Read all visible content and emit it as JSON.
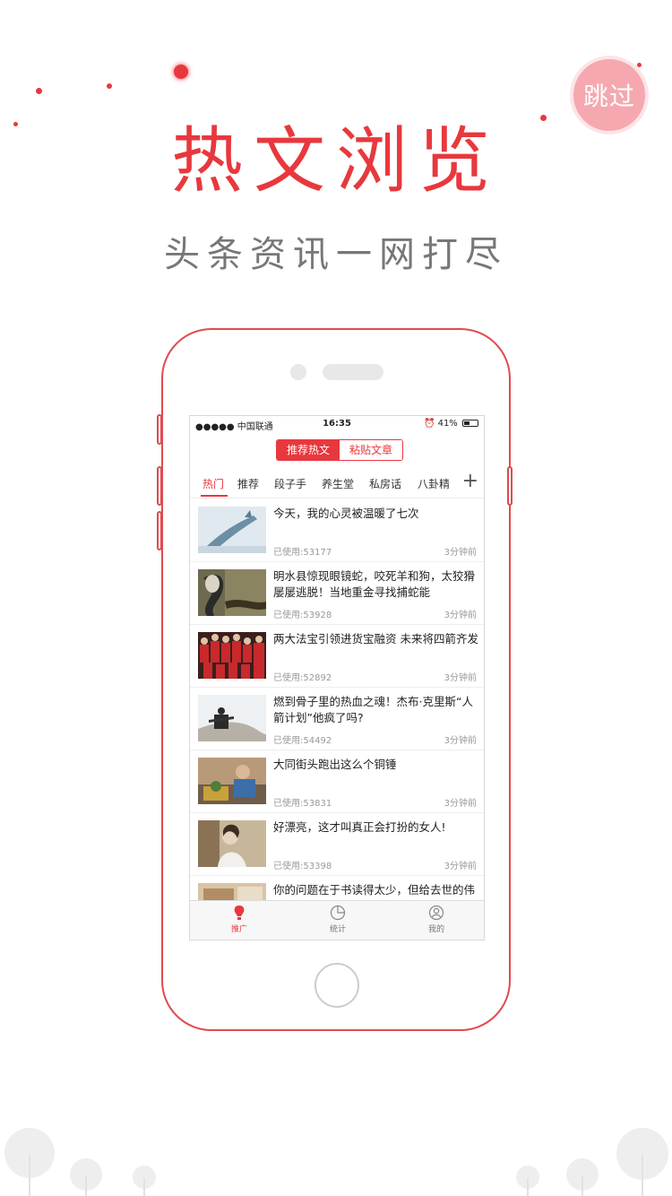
{
  "skip_label": "跳过",
  "hero": {
    "title": "热文浏览",
    "subtitle": "头条资讯一网打尽"
  },
  "status": {
    "carrier": "●●●●● 中国联通",
    "time": "16:35",
    "battery": "41%"
  },
  "segments": [
    {
      "label": "推荐热文",
      "active": true
    },
    {
      "label": "粘贴文章",
      "active": false
    }
  ],
  "tabs": [
    {
      "label": "热门",
      "active": true
    },
    {
      "label": "推荐",
      "active": false
    },
    {
      "label": "段子手",
      "active": false
    },
    {
      "label": "养生堂",
      "active": false
    },
    {
      "label": "私房话",
      "active": false
    },
    {
      "label": "八卦精",
      "active": false
    }
  ],
  "articles": [
    {
      "title": "今天，我的心灵被温暖了七次",
      "used": "已使用:53177",
      "time": "3分钟前"
    },
    {
      "title": "明水县惊现眼镜蛇，咬死羊和狗，太狡猾屡屡逃脱！当地重金寻找捕蛇能",
      "used": "已使用:53928",
      "time": "3分钟前"
    },
    {
      "title": "两大法宝引领进货宝融资 未来将四箭齐发",
      "used": "已使用:52892",
      "time": "3分钟前"
    },
    {
      "title": "燃到骨子里的热血之魂！杰布·克里斯“人箭计划”他疯了吗?",
      "used": "已使用:54492",
      "time": "3分钟前"
    },
    {
      "title": "大同街头跑出这么个铜锤",
      "used": "已使用:53831",
      "time": "3分钟前"
    },
    {
      "title": "好漂亮，这才叫真正会打扮的女人!",
      "used": "已使用:53398",
      "time": "3分钟前"
    },
    {
      "title": "你的问题在于书读得太少，但给去世的伟表点的错结点名",
      "used": "",
      "time": ""
    }
  ],
  "tabbar": [
    {
      "label": "推广",
      "icon": "lightbulb-icon",
      "active": true
    },
    {
      "label": "统计",
      "icon": "pie-chart-icon",
      "active": false
    },
    {
      "label": "我的",
      "icon": "user-icon",
      "active": false
    }
  ],
  "colors": {
    "accent": "#e8383d",
    "skip_bg": "#f5a8b0"
  }
}
